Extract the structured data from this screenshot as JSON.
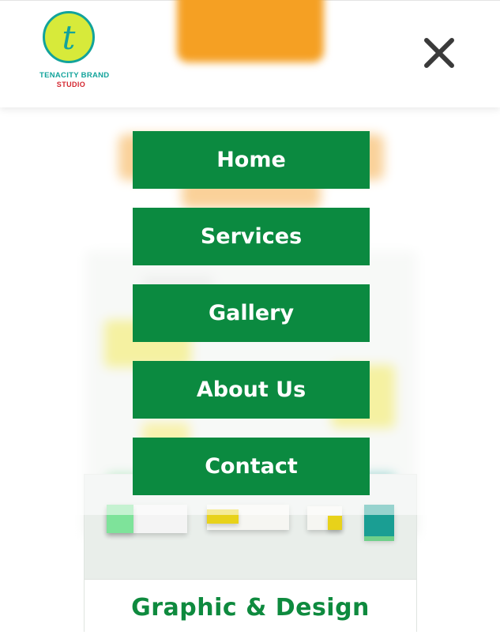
{
  "brand": {
    "logo_letter": "t",
    "name_line1": "TENACITY BRAND",
    "name_line2": "STUDIO",
    "colors": {
      "teal": "#12a39b",
      "lime": "#d7ea3a",
      "red": "#d4262f"
    }
  },
  "header": {
    "close_icon": "close-icon"
  },
  "menu": {
    "items": [
      {
        "label": "Home"
      },
      {
        "label": "Services"
      },
      {
        "label": "Gallery"
      },
      {
        "label": "About Us"
      },
      {
        "label": "Contact"
      }
    ],
    "colors": {
      "button_bg": "#0b8a40",
      "button_text": "#ffffff"
    }
  },
  "page": {
    "card_title": "Graphic & Design",
    "accent_orange": "#f39a1e"
  }
}
